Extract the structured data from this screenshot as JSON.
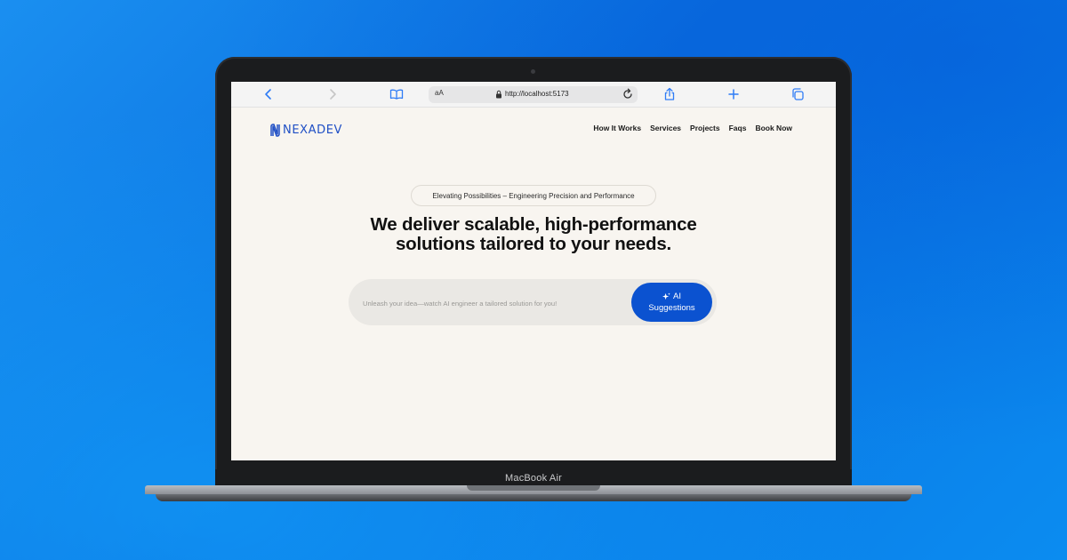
{
  "device": {
    "label": "MacBook Air"
  },
  "browser": {
    "text_size_label": "aA",
    "url": "http://localhost:5173",
    "icons": [
      "back-icon",
      "forward-icon",
      "reader-icon",
      "lock-icon",
      "reload-icon",
      "share-icon",
      "new-tab-icon",
      "tabs-icon"
    ],
    "accent_color": "#2f7cf6"
  },
  "site": {
    "logo": "NEXADEV",
    "nav": [
      {
        "label": "How It Works"
      },
      {
        "label": "Services"
      },
      {
        "label": "Projects"
      },
      {
        "label": "Faqs"
      },
      {
        "label": "Book Now"
      }
    ],
    "tagline": "Elevating Possibilities – Engineering Precision and Performance",
    "headline_line1": "We deliver scalable, high-performance",
    "headline_line2": "solutions tailored to your needs.",
    "search": {
      "placeholder": "Unleash your idea—watch AI engineer a tailored solution for you!",
      "value": ""
    },
    "ai_button": {
      "line1": "AI",
      "line2": "Suggestions",
      "color": "#0b52d0"
    },
    "background_color": "#f8f5f0",
    "brand_color": "#1f4fc5"
  }
}
